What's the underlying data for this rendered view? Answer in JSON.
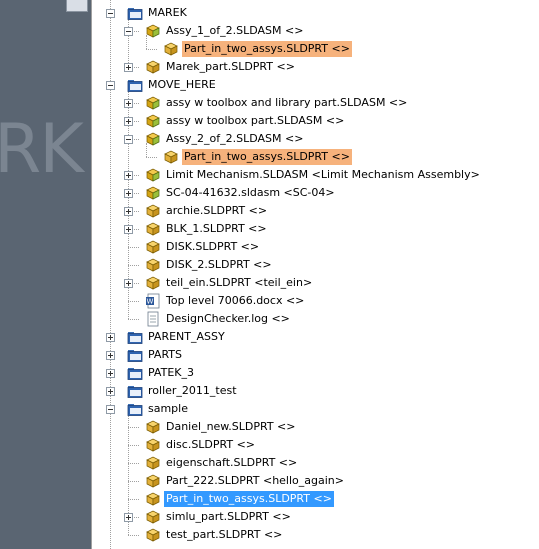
{
  "tree": {
    "rows": [
      {
        "label": "MAREK",
        "icon": "folder-icon",
        "level": 0,
        "expander": "minus"
      },
      {
        "label": "Assy_1_of_2.SLDASM <>",
        "icon": "assembly-icon",
        "level": 1,
        "expander": "minus"
      },
      {
        "label": "Part_in_two_assys.SLDPRT <>",
        "icon": "part-icon",
        "level": 2,
        "expander": "",
        "highlight": "orange"
      },
      {
        "label": "Marek_part.SLDPRT <>",
        "icon": "part-icon",
        "level": 1,
        "expander": "plus"
      },
      {
        "label": "MOVE_HERE",
        "icon": "folder-icon",
        "level": 0,
        "expander": "minus"
      },
      {
        "label": "assy w toolbox and library part.SLDASM <>",
        "icon": "assembly-icon",
        "level": 1,
        "expander": "plus"
      },
      {
        "label": "assy w toolbox part.SLDASM <>",
        "icon": "assembly-icon",
        "level": 1,
        "expander": "plus"
      },
      {
        "label": "Assy_2_of_2.SLDASM <>",
        "icon": "assembly-icon",
        "level": 1,
        "expander": "minus"
      },
      {
        "label": "Part_in_two_assys.SLDPRT <>",
        "icon": "part-icon",
        "level": 2,
        "expander": "",
        "highlight": "orange"
      },
      {
        "label": "Limit Mechanism.SLDASM <Limit Mechanism Assembly>",
        "icon": "assembly-icon",
        "level": 1,
        "expander": "plus"
      },
      {
        "label": "SC-04-41632.sldasm <SC-04>",
        "icon": "assembly-icon",
        "level": 1,
        "expander": "plus"
      },
      {
        "label": "archie.SLDPRT <>",
        "icon": "part-icon",
        "level": 1,
        "expander": "plus"
      },
      {
        "label": "BLK_1.SLDPRT <>",
        "icon": "part-icon",
        "level": 1,
        "expander": "plus"
      },
      {
        "label": "DISK.SLDPRT <>",
        "icon": "part-icon",
        "level": 1,
        "expander": ""
      },
      {
        "label": "DISK_2.SLDPRT <>",
        "icon": "part-icon",
        "level": 1,
        "expander": ""
      },
      {
        "label": "teil_ein.SLDPRT <teil_ein>",
        "icon": "part-icon",
        "level": 1,
        "expander": "plus"
      },
      {
        "label": "Top level 70066.docx <>",
        "icon": "word-doc-icon",
        "level": 1,
        "expander": ""
      },
      {
        "label": "DesignChecker.log <>",
        "icon": "text-file-icon",
        "level": 1,
        "expander": ""
      },
      {
        "label": "PARENT_ASSY",
        "icon": "folder-icon",
        "level": 0,
        "expander": "plus"
      },
      {
        "label": "PARTS",
        "icon": "folder-icon",
        "level": 0,
        "expander": "plus"
      },
      {
        "label": "PATEK_3",
        "icon": "folder-icon",
        "level": 0,
        "expander": "plus"
      },
      {
        "label": "roller_2011_test",
        "icon": "folder-icon",
        "level": 0,
        "expander": "plus"
      },
      {
        "label": "sample",
        "icon": "folder-icon",
        "level": 0,
        "expander": "minus"
      },
      {
        "label": "Daniel_new.SLDPRT <>",
        "icon": "part-icon",
        "level": 1,
        "expander": ""
      },
      {
        "label": "disc.SLDPRT <>",
        "icon": "part-icon",
        "level": 1,
        "expander": ""
      },
      {
        "label": "eigenschaft.SLDPRT <>",
        "icon": "part-icon",
        "level": 1,
        "expander": ""
      },
      {
        "label": "Part_222.SLDPRT <hello_again>",
        "icon": "part-icon",
        "level": 1,
        "expander": ""
      },
      {
        "label": "Part_in_two_assys.SLDPRT <>",
        "icon": "part-icon",
        "level": 1,
        "expander": "",
        "highlight": "blue"
      },
      {
        "label": "simlu_part.SLDPRT <>",
        "icon": "part-icon",
        "level": 1,
        "expander": "plus"
      },
      {
        "label": "test_part.SLDPRT <>",
        "icon": "part-icon",
        "level": 1,
        "expander": ""
      }
    ]
  },
  "left_panel": {
    "watermark": "RK"
  },
  "colors": {
    "orange_highlight": "#f6b27c",
    "blue_selection": "#3399ff",
    "panel": "#5a6572"
  }
}
